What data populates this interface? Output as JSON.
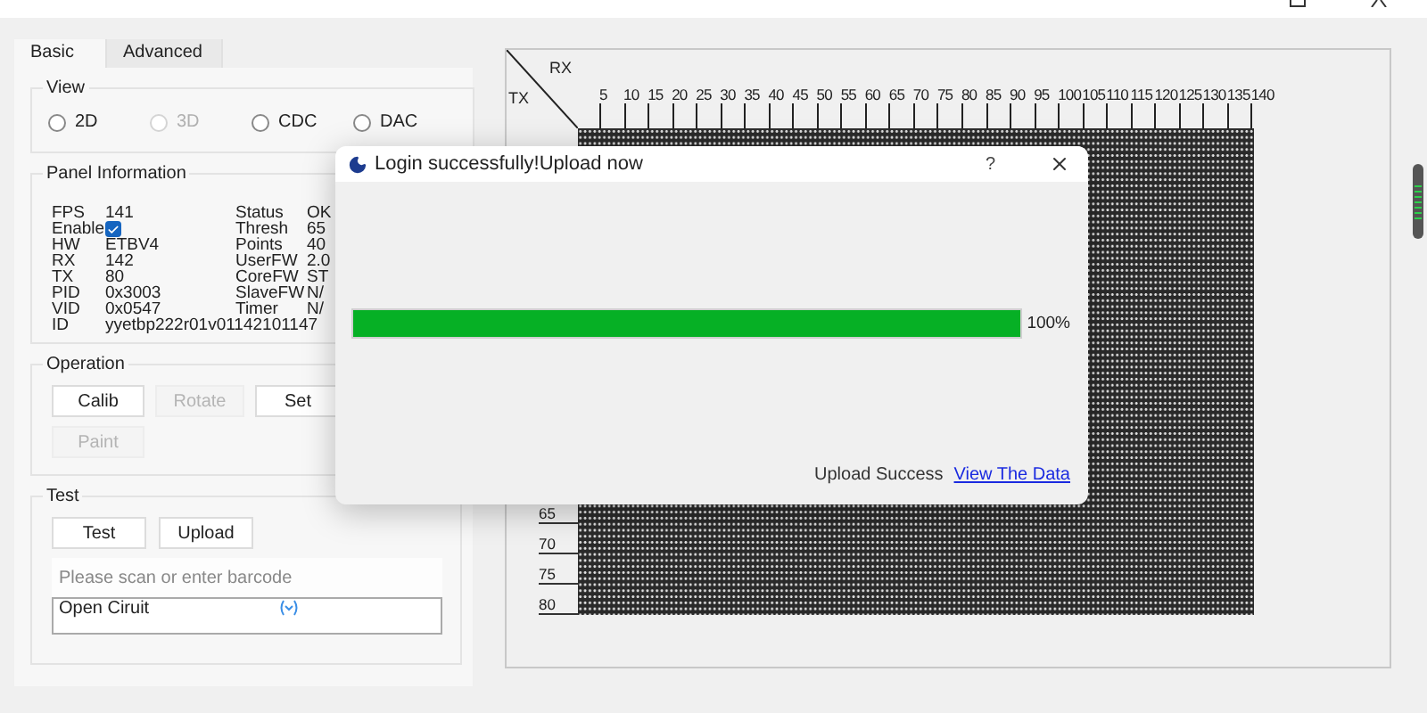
{
  "tabs": [
    {
      "label": "Basic",
      "selected": true
    },
    {
      "label": "Advanced",
      "selected": false
    }
  ],
  "view": {
    "title": "View",
    "options": [
      {
        "label": "2D",
        "selected": false,
        "disabled": false
      },
      {
        "label": "3D",
        "selected": false,
        "disabled": true
      },
      {
        "label": "CDC",
        "selected": false,
        "disabled": false
      },
      {
        "label": "DAC",
        "selected": false,
        "disabled": false
      }
    ]
  },
  "panel_information": {
    "title": "Panel Information",
    "left": [
      {
        "kind": "text",
        "label": "FPS",
        "value": "141"
      },
      {
        "kind": "checkbox",
        "label": "Enable",
        "checked": true
      },
      {
        "kind": "text",
        "label": "HW",
        "value": "ETBV4"
      },
      {
        "kind": "text",
        "label": "RX",
        "value": "142"
      },
      {
        "kind": "text",
        "label": "TX",
        "value": "80"
      },
      {
        "kind": "text",
        "label": "PID",
        "value": "0x3003"
      },
      {
        "kind": "text",
        "label": "VID",
        "value": "0x0547"
      },
      {
        "kind": "text",
        "label": "ID",
        "value": "yyetbp222r01v01142101147"
      }
    ],
    "right": [
      {
        "label": "Status",
        "value": "OK"
      },
      {
        "label": "Thresh",
        "value": "65"
      },
      {
        "label": "Points",
        "value": "40"
      },
      {
        "label": "UserFW",
        "value": "2.0"
      },
      {
        "label": "CoreFW",
        "value": "ST"
      },
      {
        "label": "SlaveFW",
        "value": "N/"
      },
      {
        "label": "Timer",
        "value": "N/"
      }
    ]
  },
  "operation": {
    "title": "Operation",
    "buttons": [
      {
        "label": "Calib",
        "disabled": false
      },
      {
        "label": "Rotate",
        "disabled": true
      },
      {
        "label": "Set",
        "disabled": false
      },
      {
        "label": "Paint",
        "disabled": true
      }
    ]
  },
  "test": {
    "title": "Test",
    "buttons": [
      {
        "label": "Test"
      },
      {
        "label": "Upload"
      }
    ],
    "barcode": {
      "placeholder": "Please scan or enter barcode"
    },
    "result": {
      "text": "Open Ciruit"
    }
  },
  "touch_map": {
    "rx_label": "RX",
    "tx_label": "TX",
    "columns": [
      "5",
      "10",
      "15",
      "20",
      "25",
      "30",
      "35",
      "40",
      "45",
      "50",
      "55",
      "60",
      "65",
      "70",
      "75",
      "80",
      "85",
      "90",
      "95",
      "100",
      "105",
      "110",
      "115",
      "120",
      "125",
      "130",
      "135",
      "140"
    ],
    "rows": [
      "65",
      "70",
      "75",
      "80"
    ]
  },
  "dialog": {
    "title": "Login successfully!Upload now",
    "help": "?",
    "progress": {
      "level": 1,
      "reading": "100%"
    },
    "status": "Upload Success",
    "link": "View The Data"
  }
}
